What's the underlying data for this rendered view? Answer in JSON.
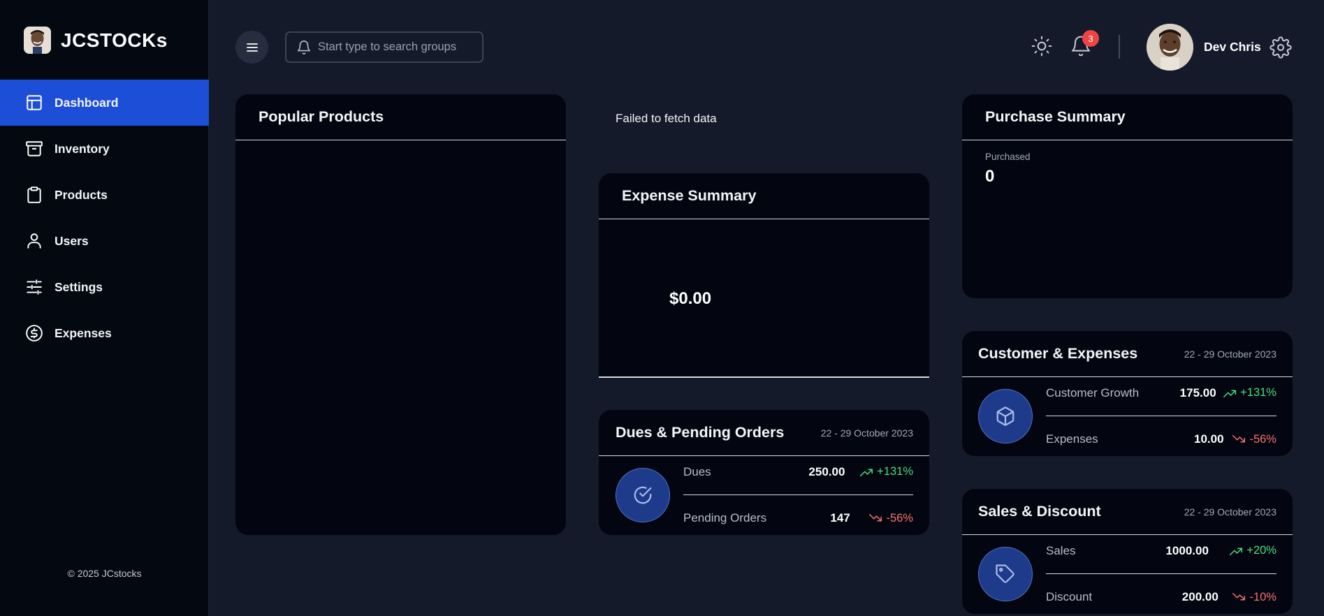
{
  "brand": {
    "name": "JCSTOCKs"
  },
  "sidebar": {
    "items": [
      {
        "label": "Dashboard",
        "icon": "layout-icon",
        "active": true
      },
      {
        "label": "Inventory",
        "icon": "archive-icon",
        "active": false
      },
      {
        "label": "Products",
        "icon": "clipboard-icon",
        "active": false
      },
      {
        "label": "Users",
        "icon": "user-icon",
        "active": false
      },
      {
        "label": "Settings",
        "icon": "sliders-icon",
        "active": false
      },
      {
        "label": "Expenses",
        "icon": "dollar-circle-icon",
        "active": false
      }
    ],
    "copyright": "© 2025 JCstocks"
  },
  "header": {
    "search_placeholder": "Start type to search groups",
    "notification_count": "3",
    "user_name": "Dev Chris"
  },
  "popular_products": {
    "title": "Popular Products"
  },
  "error": {
    "message": "Failed to fetch data"
  },
  "expense_summary": {
    "title": "Expense Summary",
    "amount": "$0.00"
  },
  "purchase_summary": {
    "title": "Purchase Summary",
    "label": "Purchased",
    "value": "0"
  },
  "dues": {
    "title": "Dues & Pending Orders",
    "date": "22 - 29 October 2023",
    "rows": [
      {
        "label": "Dues",
        "value": "250.00",
        "change": "+131%",
        "trend": "up"
      },
      {
        "label": "Pending Orders",
        "value": "147",
        "change": "-56%",
        "trend": "down"
      }
    ]
  },
  "customer_expenses": {
    "title": "Customer & Expenses",
    "date": "22 - 29 October 2023",
    "rows": [
      {
        "label": "Customer Growth",
        "value": "175.00",
        "change": "+131%",
        "trend": "up"
      },
      {
        "label": "Expenses",
        "value": "10.00",
        "change": "-56%",
        "trend": "down"
      }
    ]
  },
  "sales_discount": {
    "title": "Sales & Discount",
    "date": "22 - 29 October 2023",
    "rows": [
      {
        "label": "Sales",
        "value": "1000.00",
        "change": "+20%",
        "trend": "up"
      },
      {
        "label": "Discount",
        "value": "200.00",
        "change": "-10%",
        "trend": "down"
      }
    ]
  },
  "colors": {
    "accent": "#1d4ed8",
    "background": "#141a2a",
    "sidebar": "#040810",
    "card": "#030610",
    "positive": "#4ade80",
    "negative": "#f87171",
    "badge": "#ef4444"
  }
}
